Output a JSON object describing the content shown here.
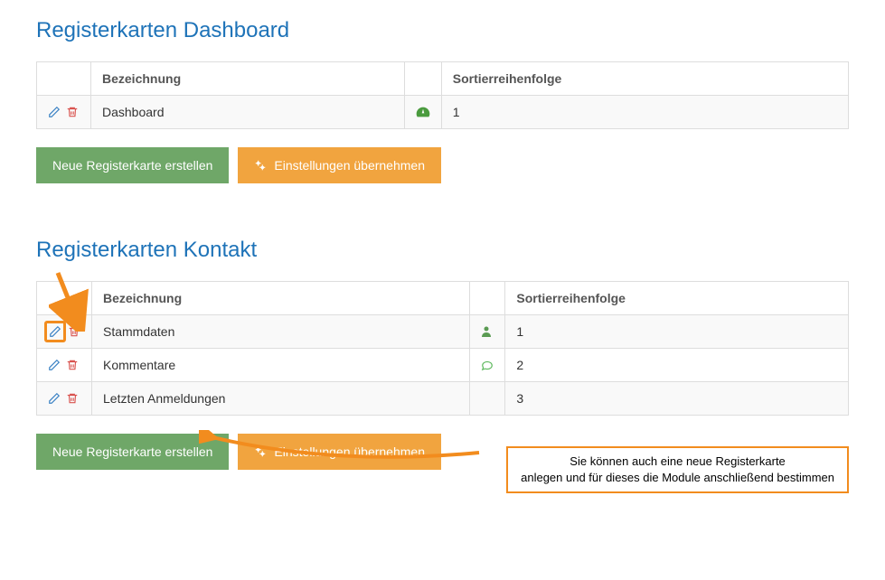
{
  "sections": [
    {
      "title": "Registerkarten Dashboard",
      "columns": {
        "name": "Bezeichnung",
        "sort": "Sortierreihenfolge"
      },
      "rows": [
        {
          "name": "Dashboard",
          "icon": "dashboard",
          "sort": "1",
          "highlight_edit": false
        }
      ],
      "buttons": {
        "create": "Neue Registerkarte erstellen",
        "apply": "Einstellungen übernehmen"
      }
    },
    {
      "title": "Registerkarten Kontakt",
      "columns": {
        "name": "Bezeichnung",
        "sort": "Sortierreihenfolge"
      },
      "rows": [
        {
          "name": "Stammdaten",
          "icon": "user",
          "sort": "1",
          "highlight_edit": true
        },
        {
          "name": "Kommentare",
          "icon": "comment",
          "sort": "2",
          "highlight_edit": false
        },
        {
          "name": "Letzten Anmeldungen",
          "icon": "",
          "sort": "3",
          "highlight_edit": false
        }
      ],
      "buttons": {
        "create": "Neue Registerkarte erstellen",
        "apply": "Einstellungen übernehmen"
      }
    }
  ],
  "callout": {
    "line1": "Sie können auch eine neue Registerkarte",
    "line2": "anlegen und für dieses die Module anschließend bestimmen"
  }
}
